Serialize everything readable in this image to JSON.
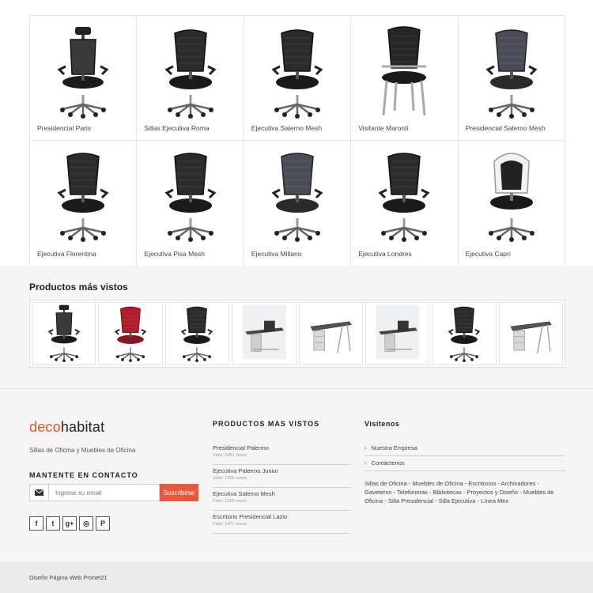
{
  "products": [
    {
      "name": "Presidencial Paris",
      "icon": "chair-headrest-icon"
    },
    {
      "name": "Sillas Ejecutiva Roma",
      "icon": "chair-mesh-icon"
    },
    {
      "name": "Ejecutiva Salerno Mesh",
      "icon": "chair-mesh-icon"
    },
    {
      "name": "Visitante Maronti",
      "icon": "chair-visitor-icon"
    },
    {
      "name": "Presidencial Salerno Mesh",
      "icon": "chair-mesh-icon"
    },
    {
      "name": "Ejecutiva Florentina",
      "icon": "chair-mesh-icon"
    },
    {
      "name": "Ejecutiva Pisa Mesh",
      "icon": "chair-mesh-icon"
    },
    {
      "name": "Ejecutiva Millano",
      "icon": "chair-mesh-icon"
    },
    {
      "name": "Ejecutiva Londres",
      "icon": "chair-mesh-icon"
    },
    {
      "name": "Ejecutiva Capri",
      "icon": "chair-shell-icon"
    }
  ],
  "most_viewed": {
    "title": "Productos más vistos",
    "items": [
      "chair-headrest-icon",
      "chair-red-icon",
      "chair-mesh-icon",
      "desk-set-icon",
      "desk-icon",
      "desk-set-icon",
      "chair-mesh-icon",
      "desk-icon"
    ]
  },
  "footer": {
    "logo_part1": "deco",
    "logo_part2": "habitat",
    "tagline": "Sillas de Oficina y Muebles de Oficina",
    "contact_title": "MANTENTE EN CONTACTO",
    "email_placeholder": "Ingrese su email",
    "subscribe_label": "Suscribirse",
    "social": [
      {
        "icon": "facebook-icon",
        "glyph": "f"
      },
      {
        "icon": "twitter-icon",
        "glyph": "t"
      },
      {
        "icon": "google-plus-icon",
        "glyph": "g+"
      },
      {
        "icon": "instagram-icon",
        "glyph": "◎"
      },
      {
        "icon": "pinterest-icon",
        "glyph": "P"
      }
    ],
    "popular_title": "PRODUCTOS MAS VISTOS",
    "popular": [
      {
        "name": "Presidencial Palermo",
        "views": "Visto: 2481 veces"
      },
      {
        "name": "Ejecutiva Palermo Junior",
        "views": "Visto: 1906 veces"
      },
      {
        "name": "Ejecutiva Salerno Mesh",
        "views": "Visto: 1569 veces"
      },
      {
        "name": "Escritorio Presidencial Lazio",
        "views": "Visto: 1477 veces"
      }
    ],
    "visit_title": "Visítenos",
    "visit_links": [
      "Nuestra Empresa",
      "Contáctenos"
    ],
    "categories_text": "Sillas de Oficina - Muebles de Oficina - Escritorios - Archivadores - Gaveteros - Telefoneras - Bibliotecas - Proyectos y Diseño - Muebles de Oficina - Silla Presidencial - Silla Ejecutiva - Línea Mex",
    "credit": "Diseño Página Web Pronet21"
  },
  "colors": {
    "brand_orange": "#e8531f",
    "subscribe_button": "#e8583a",
    "footer_bg": "#f5f5f5",
    "bottom_bar": "#ebebeb"
  }
}
